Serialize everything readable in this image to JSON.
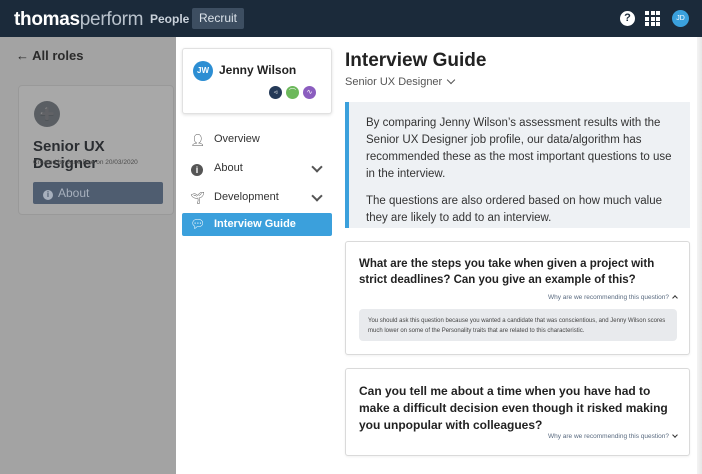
{
  "topbar": {
    "logo_bold": "thomas",
    "logo_light": "perform",
    "nav_people": "People",
    "nav_recruit": "Recruit",
    "help_icon": "?",
    "grid_icon": "apps-grid",
    "user_initials": "JD"
  },
  "left_panel": {
    "back_label": "← All roles",
    "role_icon": "user-add",
    "role_title": "Senior UX Designer",
    "role_created": "Created by Jane Doe on 20/03/2020",
    "about_label": "About"
  },
  "candidate": {
    "initials": "JW",
    "name": "Jenny Wilson",
    "badges": [
      "◃",
      "⌒",
      "∿"
    ]
  },
  "side_nav": {
    "items": [
      {
        "label": "Overview",
        "icon": "person-check"
      },
      {
        "label": "About",
        "icon": "info"
      },
      {
        "label": "Development",
        "icon": "sprout"
      },
      {
        "label": "Interview Guide",
        "icon": "chat-bubbles"
      }
    ]
  },
  "main": {
    "title": "Interview Guide",
    "role_select": "Senior UX Designer",
    "info_p1": "By comparing Jenny Wilson’s assessment results with the Senior UX Designer job profile, our data/algorithm has recommended these as the most important questions to use in the interview.",
    "info_p2": "The questions are also ordered based on how much value they are likely to add to an interview.",
    "questions": [
      {
        "text": "What are the steps you take when given a project with strict deadlines? Can you give an example of this?",
        "why_label": "Why are we recommending this question?",
        "reason": "You should ask this question because you wanted a candidate that was conscientious, and Jenny Wilson scores much lower on some of the Personality traits that are related to this characteristic."
      },
      {
        "text": "Can you tell me about a time when you have had to make a difficult decision even though it risked making you unpopular with colleagues?",
        "why_label": "Why are we recommending this question?"
      }
    ]
  },
  "colors": {
    "topbar": "#1b2a3a",
    "accent": "#3ba0dc",
    "overlay_grey": "#a3a3a3"
  }
}
